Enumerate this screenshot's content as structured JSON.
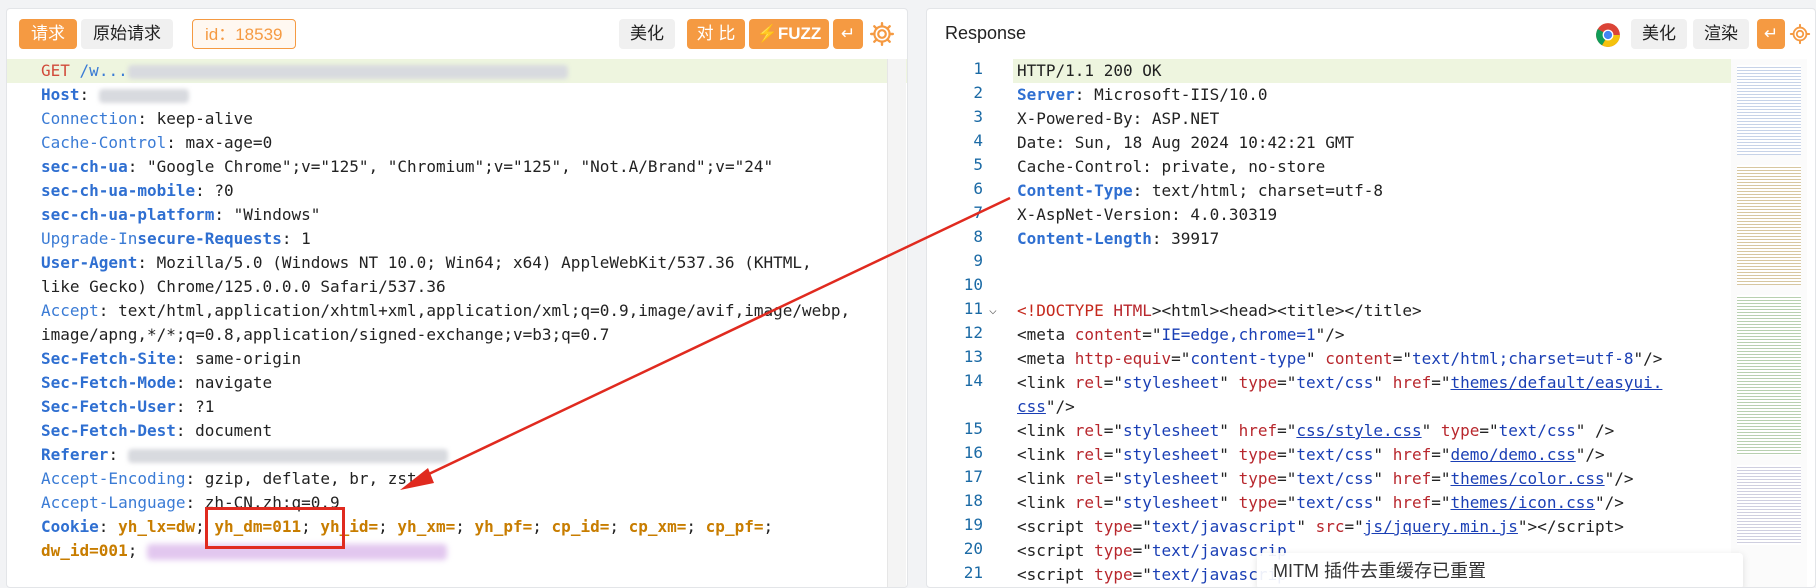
{
  "request_panel": {
    "tab_request": "请求",
    "tab_raw": "原始请求",
    "id_badge": "id：18539",
    "btn_beautify": "美化",
    "btn_compare": "对 比",
    "btn_fuzz": "FUZZ",
    "lines": {
      "l1_method": "GET",
      "l1_path": "/w...",
      "l2_key": "Host",
      "l3_key": "Connection",
      "l3_val": "keep-alive",
      "l4_key": "Cache-Control",
      "l4_val": "max-age=0",
      "l5_key": "sec-ch-ua",
      "l5_val": "\"Google Chrome\";v=\"125\", \"Chromium\";v=\"125\", \"Not.A/Brand\";v=\"24\"",
      "l6_key": "sec-ch-ua-mobile",
      "l6_val": "?0",
      "l7_key": "sec-ch-ua-platform",
      "l7_val": "\"Windows\"",
      "l8_key_a": "Upgrade-In",
      "l8_key_b": "secure-Requests",
      "l8_val": "1",
      "l9_key": "User-Agent",
      "l9_val": "Mozilla/5.0 (Windows NT 10.0; Win64; x64) AppleWebKit/537.36 (KHTML,",
      "l10_val": "like Gecko) Chrome/125.0.0.0 Safari/537.36",
      "l11_key": "Accept",
      "l11_val": "text/html,application/xhtml+xml,application/xml;q=0.9,image/avif,image/webp,",
      "l12_val": "image/apng,*/*;q=0.8,application/signed-exchange;v=b3;q=0.7",
      "l13_key": "Sec-Fetch-Site",
      "l13_val": "same-origin",
      "l14_key": "Sec-Fetch-Mode",
      "l14_val": "navigate",
      "l15_key": "Sec-Fetch-User",
      "l15_val": "?1",
      "l16_key": "Sec-Fetch-Dest",
      "l16_val": "document",
      "l17_key": "Referer",
      "l18_key": "Accept-Encoding",
      "l18_val": "gzip, deflate, br, zstd",
      "l19_key": "Accept-Language",
      "l19_val": "zh-CN,zh;q=0.9",
      "l20_key": "Cookie",
      "cookie_1": "yh_lx=dw",
      "cookie_2": "yh_dm=011",
      "cookie_3": "yh_id=",
      "cookie_4": "yh_xm=",
      "cookie_5": "yh_pf=",
      "cookie_6": "cp_id=",
      "cookie_7": "cp_xm=",
      "cookie_8": "cp_pf=",
      "l21_val": "dw_id=001"
    }
  },
  "response_panel": {
    "title": "Response",
    "btn_beautify": "美化",
    "btn_render": "渲染",
    "toast": "MITM 插件去重缓存已重置",
    "line_numbers": [
      "1",
      "2",
      "3",
      "4",
      "5",
      "6",
      "7",
      "8",
      "9",
      "10",
      "11",
      "12",
      "13",
      "14",
      "",
      "15",
      "16",
      "17",
      "18",
      "19",
      "20",
      "21"
    ],
    "lines": {
      "r1": "HTTP/1.1 200 OK",
      "r2_key": "Server",
      "r2_val": "Microsoft-IIS/10.0",
      "r3": "X-Powered-By: ASP.NET",
      "r4": "Date: Sun, 18 Aug 2024 10:42:21 GMT",
      "r5": "Cache-Control: private, no-store",
      "r6_key": "Content-Type",
      "r6_val": "text/html; charset=utf-8",
      "r7": "X-AspNet-Version: 4.0.30319",
      "r8_key": "Content-Length",
      "r8_val": "39917",
      "r11_doctype": "<!DOCTYPE",
      "r11_html_kw": "HTML",
      "r11_rest": "><html><head><title></title>",
      "r12_a": "IE=edge,chrome=1",
      "r13_a": "content-type",
      "r13_b": "text/html;charset=utf-8",
      "r14_a": "stylesheet",
      "r14_b": "text/css",
      "r14_c": "themes/default/easyui.",
      "r14w": "css",
      "r15_a": "stylesheet",
      "r15_b": "css/style.css",
      "r15_c": "text/css",
      "r16_a": "stylesheet",
      "r16_b": "text/css",
      "r16_c": "demo/demo.css",
      "r17_a": "stylesheet",
      "r17_b": "text/css",
      "r17_c": "themes/color.css",
      "r18_a": "stylesheet",
      "r18_b": "text/css",
      "r18_c": "themes/icon.css",
      "r19_a": "text/javascript",
      "r19_b": "js/jquery.min.js",
      "r20_a": "text/javascrip",
      "r21_a": "text/javascrip"
    }
  },
  "colors": {
    "accent": "#f59a42",
    "arrow": "#e02a1f",
    "key_blue": "#2f6fd1"
  }
}
